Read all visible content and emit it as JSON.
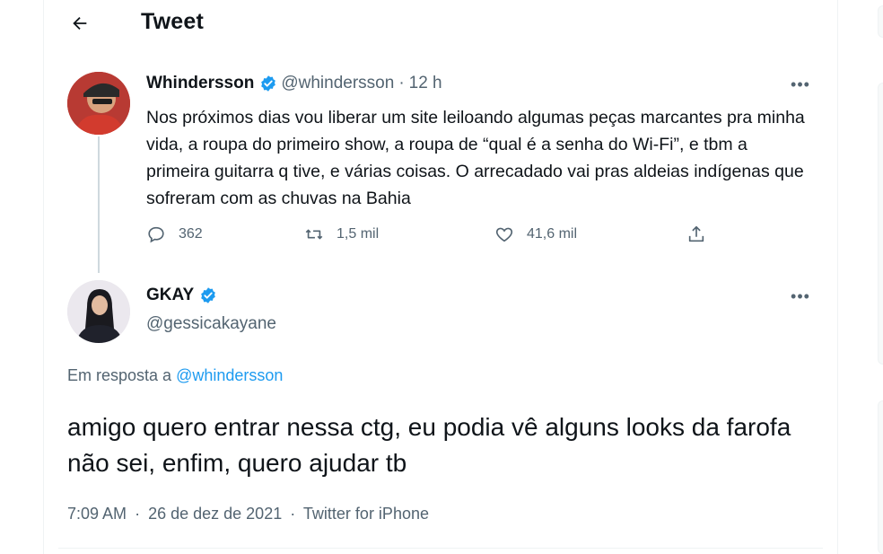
{
  "header": {
    "title": "Tweet"
  },
  "colors": {
    "accent": "#1d9bf0",
    "secondary_text": "#536471",
    "primary_text": "#0f1419"
  },
  "tweet1": {
    "name": "Whindersson",
    "handle": "@whindersson",
    "time": "12 h",
    "text": "Nos próximos dias vou liberar um site leiloando algumas peças marcantes pra minha vida, a roupa do primeiro show, a roupa de “qual é a senha do Wi-Fi”, e tbm a primeira guitarra q tive, e várias coisas. O arrecadado vai pras aldeias indígenas que sofreram com as chuvas na Bahia",
    "replies": "362",
    "retweets": "1,5 mil",
    "likes": "41,6 mil",
    "icons": {
      "reply": "reply-icon",
      "retweet": "retweet-icon",
      "like": "heart-icon",
      "share": "share-icon"
    }
  },
  "tweet2": {
    "name": "GKAY",
    "handle": "@gessicakayane",
    "reply_prefix": "Em resposta a",
    "reply_mention": "@whindersson",
    "text": "amigo quero entrar nessa ctg, eu podia vê alguns looks da farofa não sei, enfim, quero ajudar tb",
    "meta_time": "7:09 AM",
    "meta_date": "26 de dez de 2021",
    "meta_source": "Twitter for iPhone"
  },
  "symbols": {
    "more": "•••",
    "dot": "·"
  }
}
